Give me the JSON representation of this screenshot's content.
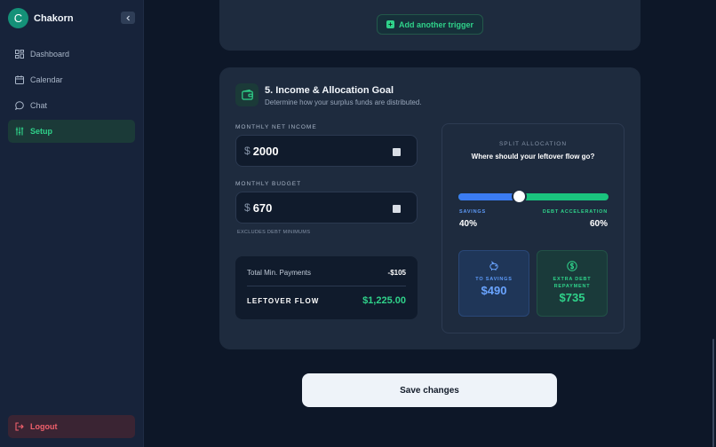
{
  "sidebar": {
    "avatar_initial": "C",
    "app_name": "Chakorn",
    "items": [
      {
        "label": "Dashboard",
        "icon": "grid-icon"
      },
      {
        "label": "Calendar",
        "icon": "calendar-icon"
      },
      {
        "label": "Chat",
        "icon": "chat-bubble-icon"
      },
      {
        "label": "Setup",
        "icon": "sliders-icon",
        "active": true
      }
    ],
    "logout_label": "Logout"
  },
  "triggers": {
    "add_label": "Add another trigger"
  },
  "income_section": {
    "title": "5. Income & Allocation Goal",
    "subtitle": "Determine how your surplus funds are distributed.",
    "income_label": "MONTHLY NET INCOME",
    "income_currency": "$",
    "income_value": "2000",
    "budget_label": "MONTHLY BUDGET",
    "budget_currency": "$",
    "budget_value": "670",
    "budget_hint": "EXCLUDES DEBT MINIMUMS",
    "min_payments_label": "Total Min. Payments",
    "min_payments_value": "-$105",
    "leftover_label": "LEFTOVER FLOW",
    "leftover_value": "$1,225.00"
  },
  "split": {
    "title": "SPLIT ALLOCATION",
    "question": "Where should your leftover flow go?",
    "savings_fraction": 0.4,
    "savings_label": "SAVINGS",
    "savings_pct": "40%",
    "debt_label": "DEBT ACCELERATION",
    "debt_pct": "60%",
    "to_savings_label": "TO SAVINGS",
    "to_savings_value": "$490",
    "extra_debt_label_1": "EXTRA DEBT",
    "extra_debt_label_2": "REPAYMENT",
    "extra_debt_value": "$735"
  },
  "actions": {
    "save_label": "Save changes"
  },
  "colors": {
    "accent_green": "#2fd28a",
    "savings_blue": "#3b7cf2",
    "danger_red": "#f0606c"
  }
}
